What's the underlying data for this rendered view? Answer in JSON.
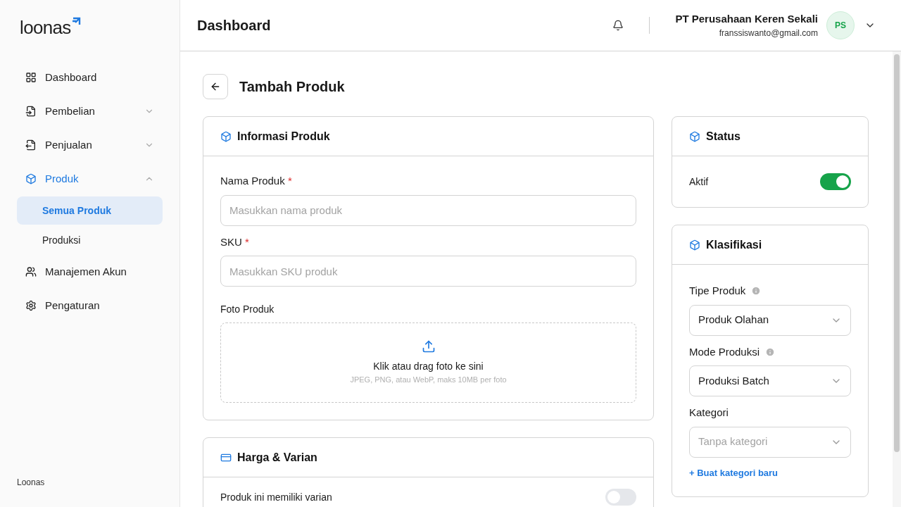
{
  "sidebar": {
    "logo": "loonas",
    "items": [
      {
        "kind": "item",
        "label": "Dashboard",
        "selected": false
      },
      {
        "kind": "group",
        "label": "Pembelian",
        "expanded": false,
        "selected": false
      },
      {
        "kind": "group",
        "label": "Penjualan",
        "expanded": false,
        "selected": false
      },
      {
        "kind": "group",
        "label": "Produk",
        "expanded": true,
        "selected": true,
        "children": [
          {
            "label": "Semua Produk",
            "selected": true
          },
          {
            "label": "Produksi",
            "selected": false
          }
        ]
      },
      {
        "kind": "item",
        "label": "Manajemen Akun",
        "selected": false
      },
      {
        "kind": "item",
        "label": "Pengaturan",
        "selected": false
      }
    ],
    "footer": "Loonas"
  },
  "header": {
    "title": "Dashboard",
    "company": "PT Perusahaan Keren Sekali",
    "email": "franssiswanto@gmail.com",
    "avatar": "PS"
  },
  "page": {
    "title": "Tambah Produk"
  },
  "info_card": {
    "title": "Informasi Produk",
    "fields": [
      {
        "label": "Nama Produk",
        "required_mark": "*",
        "placeholder": "Masukkan nama produk"
      },
      {
        "label": "SKU",
        "required_mark": "*",
        "placeholder": "Masukkan SKU produk"
      }
    ],
    "photo": {
      "label": "Foto Produk",
      "prompt": "Klik atau drag foto ke sini",
      "hint": "JPEG, PNG, atau WebP, maks 10MB per foto"
    }
  },
  "price_card": {
    "title": "Harga & Varian",
    "variant_label": "Produk ini memiliki varian",
    "variant_on": false
  },
  "status_card": {
    "title": "Status",
    "label": "Aktif",
    "on": true
  },
  "class_card": {
    "title": "Klasifikasi",
    "selects": [
      {
        "label": "Tipe Produk",
        "info": true,
        "value": "Produk Olahan"
      },
      {
        "label": "Mode Produksi",
        "info": true,
        "value": "Produksi Batch"
      },
      {
        "label": "Kategori",
        "info": false,
        "placeholder": "Tanpa kategori"
      }
    ],
    "link": "+ Buat kategori baru"
  }
}
